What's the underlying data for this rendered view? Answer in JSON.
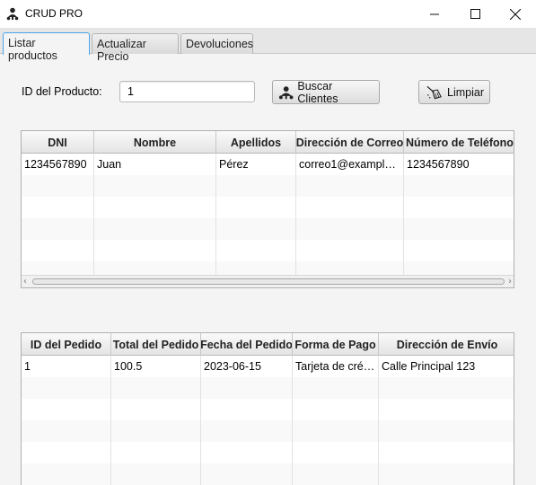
{
  "window": {
    "title": "CRUD PRO",
    "icon": "user-group-icon"
  },
  "tabs": [
    {
      "label": "Listar productos",
      "active": true
    },
    {
      "label": "Actualizar Precio",
      "active": false
    },
    {
      "label": "Devoluciones",
      "active": false
    }
  ],
  "form": {
    "product_id_label": "ID del Producto:",
    "product_id_value": "1",
    "search_button": "Buscar Clientes",
    "clear_button": "Limpiar"
  },
  "clients_table": {
    "columns": [
      "DNI",
      "Nombre",
      "Apellidos",
      "Dirección de Correo",
      "Número de Teléfono"
    ],
    "rows": [
      [
        "1234567890",
        "Juan",
        "Pérez",
        "correo1@example....",
        "1234567890"
      ]
    ]
  },
  "orders_table": {
    "columns": [
      "ID del Pedido",
      "Total del Pedido",
      "Fecha del Pedido",
      "Forma de Pago",
      "Dirección de Envío"
    ],
    "rows": [
      [
        "1",
        "100.5",
        "2023-06-15",
        "Tarjeta de créd...",
        "Calle Principal 123"
      ]
    ]
  },
  "colors": {
    "active_tab_border": "#4aa3e8",
    "header_bg": "#e4e4e4"
  }
}
